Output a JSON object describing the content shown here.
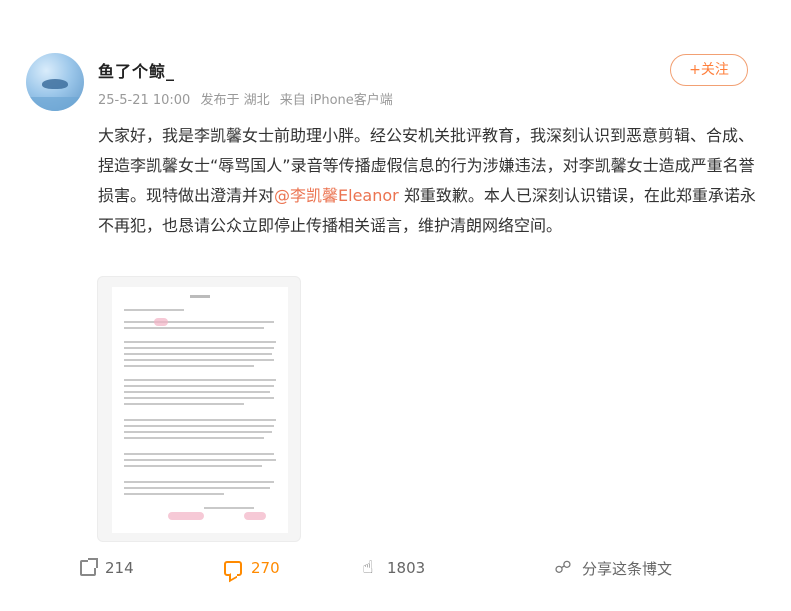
{
  "post": {
    "username": "鱼了个鲸_",
    "meta": {
      "time": "25-5-21 10:00",
      "location": "发布于 湖北",
      "source": "来自 iPhone客户端"
    },
    "follow_label": "+关注",
    "content": {
      "part1": "大家好，我是李凯馨女士前助理小胖。经公安机关批评教育，我深刻认识到恶意剪辑、合成、捏造李凯馨女士“辱骂国人”录音等传播虚假信息的行为涉嫌违法，对李凯馨女士造成严重名誉损害。现特做出澄清并对",
      "mention": "@李凯馨Eleanor",
      "part2": " 郑重致歉。本人已深刻认识错误，在此郑重承诺永不再犯，也恳请公众立即停止传播相关谣言，维护清朗网络空间。"
    },
    "attachment_icon": "document-image"
  },
  "actions": {
    "forward": {
      "icon": "forward-icon",
      "count": "214"
    },
    "comment": {
      "icon": "comment-icon",
      "count": "270"
    },
    "like": {
      "icon": "thumbs-up-icon",
      "count": "1803"
    },
    "share": {
      "icon": "share-icon",
      "label": "分享这条博文"
    }
  },
  "colors": {
    "accent": "#ff7f3b",
    "mention": "#eb7350",
    "comment_active": "#ff8a00",
    "meta_text": "#999999"
  }
}
